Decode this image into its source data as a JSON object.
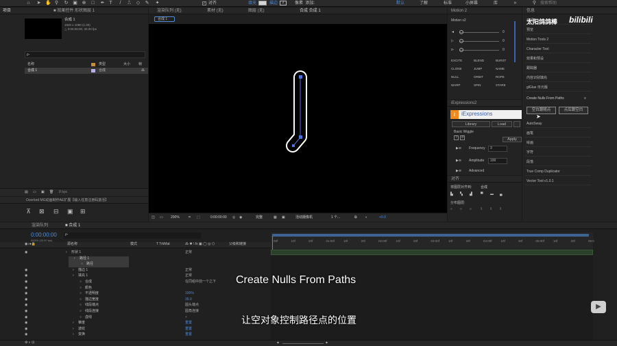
{
  "toolbar": {
    "checkbox_label": "对齐",
    "fill_label": "填充",
    "stroke_label": "描边",
    "stroke_value": "2",
    "workspaces": [
      "默认",
      "了解",
      "标准",
      "小屏幕",
      "库"
    ],
    "search_placeholder": "搜索帮助"
  },
  "project": {
    "tab": "项目",
    "tab2": "效果控件 形状图层 1",
    "comp_name": "合成 1",
    "comp_info_1": "1920 x 1080 (1.00)",
    "comp_info_2": "△ 0:00:06:00, 30.00 fps",
    "search_placeholder": "ρ-",
    "col_name": "名称",
    "col_type": "类型",
    "col_size": "大小",
    "col_frame": "帧",
    "item_name": "合成 1",
    "item_type": "合成",
    "footer": "8 bpc"
  },
  "composition": {
    "tabs": [
      "渲染队列 (无)",
      "素材 (无)",
      "图层 (无)",
      "合成 合成 1"
    ],
    "breadcrumb": "合成 1",
    "zoom": "200%",
    "timecode": "0:00:00:00",
    "quality": "完整",
    "camera": "活动摄像机",
    "views": "1 个...",
    "offset": "+0.0"
  },
  "motion": {
    "tab": "Motion 2",
    "version": "Motion v2",
    "sliders": [
      "0",
      "0",
      "0"
    ],
    "buttons": [
      "EXCITE",
      "BLEND",
      "BURST",
      "CLONE",
      "JUMP",
      "NAME",
      "NULL",
      "ORBIT",
      "ROPE",
      "WARP",
      "SPIN",
      "STARE"
    ]
  },
  "iexp": {
    "tab": "iExpressions2",
    "logo": "iExpressions",
    "btn_library": "Library",
    "btn_load": "Load",
    "section": "Basic Wiggle",
    "apply": "Apply",
    "frequency_label": "Frequency",
    "frequency_value": "3",
    "amplitude_label": "Amplitude",
    "amplitude_value": "100",
    "advanced": "Advanced"
  },
  "align": {
    "tab": "对齐",
    "align_to_label": "将图层对齐到:",
    "align_to_value": "合成",
    "distribute_label": "分布图层:"
  },
  "info": {
    "tab": "信息",
    "items": [
      "音频",
      "预览",
      "Motion Tools 2",
      "Character Tool",
      "效果和预设",
      "跟踪器",
      "内容识别填充",
      "glGlue 日元版",
      "Create Nulls From Paths",
      "AutoSway",
      "画笔",
      "绘画",
      "字符",
      "段落",
      "True Comp Duplicator",
      "Vector Tool v1.0.1"
    ],
    "script_btn_1": "空白跟随点",
    "script_btn_2": "点后跟空白"
  },
  "effects_panel": {
    "title": "Overlord MG动画制作AE扩展【输入任意注册码激活】"
  },
  "timeline": {
    "tab_render": "渲染队列",
    "tab_comp": "合成 1",
    "timecode": "0:00:00:00",
    "frame_info": "00000 (30.00 fps)",
    "col_source": "源名称",
    "col_mode": "模式",
    "col_trkmat": "T TrkMat",
    "col_parent": "父级和链接",
    "ruler": [
      "00f",
      "10f",
      "20f",
      "01:00f",
      "10f",
      "20f",
      "02:00f",
      "10f",
      "20f",
      "03:00f",
      "10f",
      "20f",
      "04:00f",
      "10f",
      "20f",
      "05:00f",
      "10f",
      "20f",
      "06:0"
    ]
  },
  "layers": [
    {
      "indent": 0,
      "label": "形状 1",
      "value": "正常"
    },
    {
      "indent": 1,
      "label": "路径 1",
      "value": ""
    },
    {
      "indent": 2,
      "label": "路径",
      "value": ""
    },
    {
      "indent": 1,
      "label": "描边 1",
      "value": "正常"
    },
    {
      "indent": 1,
      "label": "填充 1",
      "value": "正常"
    },
    {
      "indent": 2,
      "label": "合成",
      "value": "在同组中前一个之下"
    },
    {
      "indent": 2,
      "label": "颜色",
      "value": ""
    },
    {
      "indent": 2,
      "label": "不透明度",
      "value": "100%"
    },
    {
      "indent": 2,
      "label": "描边宽度",
      "value": "35.0"
    },
    {
      "indent": 2,
      "label": "线段端点",
      "value": "圆头端点"
    },
    {
      "indent": 2,
      "label": "线段连接",
      "value": "圆角连接"
    },
    {
      "indent": 2,
      "label": "虚线",
      "value": "+"
    },
    {
      "indent": 1,
      "label": "锥度",
      "value": "重置"
    },
    {
      "indent": 1,
      "label": "波纹",
      "value": "重置"
    },
    {
      "indent": 1,
      "label": "变换",
      "value": "重置"
    }
  ],
  "subtitles": {
    "en": "Create Nulls From Paths",
    "zh": "让空对象控制路径点的位置"
  },
  "watermark": {
    "text": "太阳鸽鸽棒",
    "brand": "bilibili"
  }
}
